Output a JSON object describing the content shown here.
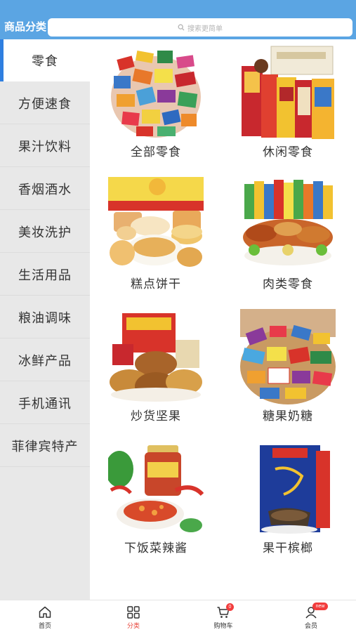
{
  "header": {
    "title": "商品分类",
    "search_placeholder": "搜索更简单"
  },
  "sidebar": {
    "items": [
      {
        "label": "零食"
      },
      {
        "label": "方便速食"
      },
      {
        "label": "果汁饮料"
      },
      {
        "label": "香烟酒水"
      },
      {
        "label": "美妆洗护"
      },
      {
        "label": "生活用品"
      },
      {
        "label": "粮油调味"
      },
      {
        "label": "冰鲜产品"
      },
      {
        "label": "手机通讯"
      },
      {
        "label": "菲律宾特产"
      }
    ],
    "active_index": 0
  },
  "grid": {
    "items": [
      {
        "label": "全部零食",
        "image": "assorted-snacks-pile"
      },
      {
        "label": "休闲零食",
        "image": "snack-gift-box"
      },
      {
        "label": "糕点饼干",
        "image": "cakes-and-pastries"
      },
      {
        "label": "肉类零食",
        "image": "meat-snacks-plate"
      },
      {
        "label": "炒货坚果",
        "image": "roasted-nuts-gift-box"
      },
      {
        "label": "糖果奶糖",
        "image": "candy-pile"
      },
      {
        "label": "下饭菜辣酱",
        "image": "chili-sauce-jar"
      },
      {
        "label": "果干槟榔",
        "image": "betel-nut-pack"
      }
    ]
  },
  "tabbar": {
    "items": [
      {
        "label": "首页",
        "icon": "home-icon"
      },
      {
        "label": "分类",
        "icon": "category-grid-icon"
      },
      {
        "label": "购物车",
        "icon": "cart-icon",
        "badge": "0"
      },
      {
        "label": "会员",
        "icon": "user-icon",
        "badge": "new"
      }
    ],
    "active_index": 1
  },
  "colors": {
    "header": "#5ba5e3",
    "active_bar": "#2f7fe0",
    "active_tab": "#e8463c",
    "badge": "#f23c3c",
    "sidebar_bg": "#e8e8e8"
  }
}
